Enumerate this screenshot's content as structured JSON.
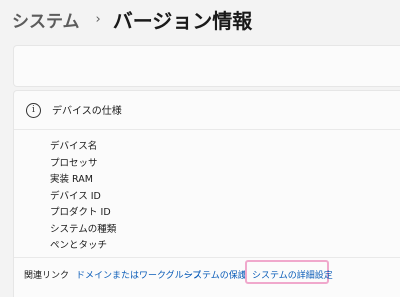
{
  "breadcrumb": {
    "parent": "システム",
    "separator": "›",
    "current": "バージョン情報"
  },
  "device_spec": {
    "icon": "info-icon",
    "title": "デバイスの仕様",
    "items": [
      "デバイス名",
      "プロセッサ",
      "実装 RAM",
      "デバイス ID",
      "プロダクト ID",
      "システムの種類",
      "ペンとタッチ"
    ]
  },
  "related_links": {
    "label": "関連リンク",
    "domain": "ドメインまたはワークグループ",
    "protection": "システムの保護",
    "advanced": "システムの詳細設定"
  },
  "colors": {
    "link": "#0a5cb8",
    "highlight": "#f0a8cc",
    "background": "#f3f3f3",
    "card": "#fbfbfb"
  }
}
